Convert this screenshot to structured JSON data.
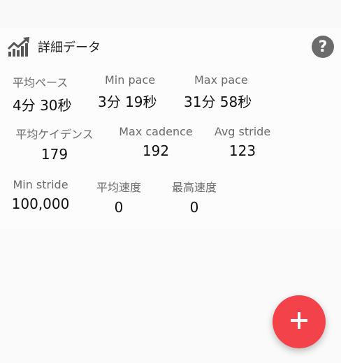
{
  "header": {
    "title": "詳細データ"
  },
  "icons": {
    "chart": "trending-up-chart-icon",
    "help": "help-circle-icon",
    "fab": "plus-icon"
  },
  "colors": {
    "fab": "#f4424b",
    "help": "#6b6b6b",
    "label": "#6b6b6b",
    "value": "#111111"
  },
  "stats": {
    "avg_pace": {
      "label": "平均ペース",
      "value": "4分 30秒"
    },
    "min_pace": {
      "label": "Min pace",
      "value": "3分 19秒"
    },
    "max_pace": {
      "label": "Max pace",
      "value": "31分 58秒"
    },
    "avg_cadence": {
      "label": "平均ケイデンス",
      "value": "179"
    },
    "max_cadence": {
      "label": "Max cadence",
      "value": "192"
    },
    "avg_stride": {
      "label": "Avg stride",
      "value": "123"
    },
    "min_stride": {
      "label": "Min stride",
      "value": "100,000"
    },
    "avg_speed": {
      "label": "平均速度",
      "value": "0"
    },
    "max_speed": {
      "label": "最高速度",
      "value": "0"
    }
  }
}
